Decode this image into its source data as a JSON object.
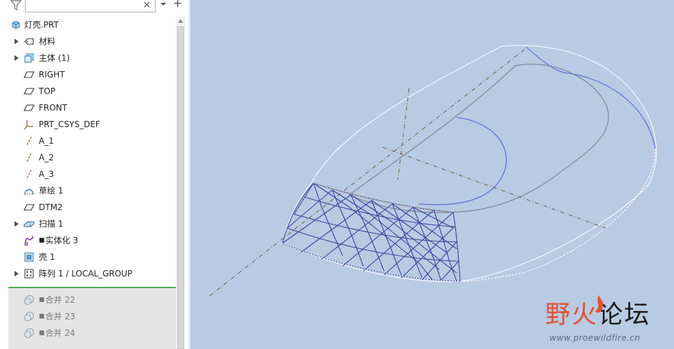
{
  "model_tree": {
    "search": {
      "value": "",
      "placeholder": ""
    },
    "clear_glyph": "×",
    "add_glyph": "+",
    "items": [
      {
        "label": "灯壳.PRT",
        "icon": "part-icon"
      },
      {
        "label": "材料",
        "icon": "material-icon"
      },
      {
        "label": "主体 (1)",
        "icon": "body-icon"
      },
      {
        "label": "RIGHT",
        "icon": "datum-plane-icon"
      },
      {
        "label": "TOP",
        "icon": "datum-plane-icon"
      },
      {
        "label": "FRONT",
        "icon": "datum-plane-icon"
      },
      {
        "label": "PRT_CSYS_DEF",
        "icon": "csys-icon"
      },
      {
        "label": "A_1",
        "icon": "datum-axis-icon"
      },
      {
        "label": "A_2",
        "icon": "datum-axis-icon"
      },
      {
        "label": "A_3",
        "icon": "datum-axis-icon"
      },
      {
        "label": "草绘 1",
        "icon": "sketch-icon"
      },
      {
        "label": "DTM2",
        "icon": "datum-plane-icon"
      },
      {
        "label": "扫描 1",
        "icon": "sweep-icon"
      },
      {
        "label": "实体化 3",
        "icon": "solidify-icon"
      },
      {
        "label": "壳 1",
        "icon": "shell-icon"
      },
      {
        "label": "阵列 1 / LOCAL_GROUP",
        "icon": "pattern-icon"
      }
    ],
    "suppressed_items": [
      {
        "label": "合并 22",
        "icon": "merge-icon"
      },
      {
        "label": "合并 23",
        "icon": "merge-icon"
      },
      {
        "label": "合并 24",
        "icon": "merge-icon"
      }
    ],
    "suppressed_flag": "■"
  },
  "watermark": {
    "brand_part1": "野火",
    "brand_part2": "论坛",
    "url": "www.proewildfire.cn"
  },
  "colors": {
    "viewport_bg": "#b7cbe3",
    "mesh_blue": "#3b3f9a",
    "edge_gray": "#7f8a95",
    "axis_brown": "#7a6a55",
    "highlight_blue": "#5a6ee0",
    "accent_green": "#4caf50"
  }
}
